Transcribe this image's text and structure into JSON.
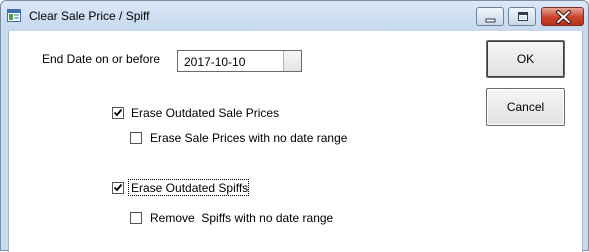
{
  "window": {
    "title": "Clear Sale Price / Spiff",
    "icon": "app-window-icon",
    "controls": [
      "minimize-icon",
      "maximize-icon",
      "close-icon"
    ]
  },
  "form": {
    "end_date_label": "End Date on or before",
    "end_date_value": "2017-10-10",
    "erase_sale_prices": {
      "label": "Erase Outdated Sale Prices",
      "checked": true
    },
    "erase_no_range_prices": {
      "label": "Erase Sale Prices with no date range",
      "checked": false
    },
    "erase_spiffs": {
      "label": "Erase Outdated Spiffs",
      "checked": true
    },
    "remove_no_range_spiffs": {
      "label": "Remove  Spiffs with no date range",
      "checked": false
    }
  },
  "buttons": {
    "ok_label": "OK",
    "cancel_label": "Cancel"
  },
  "colors": {
    "titlebar": "#c6d8ed",
    "close_button": "#c9432c"
  }
}
